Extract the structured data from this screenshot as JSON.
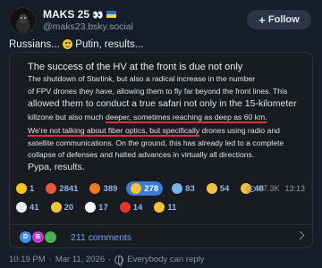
{
  "author": {
    "name": "MAKS 25",
    "emoji": "👀",
    "handle": "@maks23.bsky.social"
  },
  "follow_button": {
    "label": "Follow"
  },
  "post": {
    "text": "Russians... ",
    "text_tail": " Putin, results..."
  },
  "card": {
    "title": "The success of the HV at the front is due not only",
    "lines": [
      "The shutdown of Starlink, but also a radical increase in the number",
      "of FPV drones they have, allowing them to fly far beyond the front lines. This",
      "allowed them to conduct a true safari not only in the 15-kilometer",
      "killzone but also much deeper, sometimes reaching as deep as 60 km.",
      "We're not talking about fiber optics, but specifically drones using radio and",
      "satellite communications. On the ground, this has already led to a complete",
      "collapse of defenses and halted advances in virtually all directions.",
      "Pypa, results."
    ],
    "line4_pre": "killzone but also much ",
    "line4_underlined": "deeper, sometimes reaching as deep as 60 km.",
    "line5_underlined": "We're not talking about fiber optics, but specifically",
    "line5_post": " drones using radio and"
  },
  "reactions": {
    "row1": [
      {
        "icon": "star-icon",
        "count": "1",
        "color": "#f5c518"
      },
      {
        "icon": "angry-face-icon",
        "count": "2841",
        "color": "#e25b3c"
      },
      {
        "icon": "fire-icon",
        "count": "389",
        "color": "#f07a1a"
      },
      {
        "icon": "laughing-face-icon",
        "count": "278",
        "color": "#f6c23e",
        "active": true
      },
      {
        "icon": "shocked-face-icon",
        "count": "83",
        "color": "#7ab3e8"
      },
      {
        "icon": "thumbs-up-icon",
        "count": "54",
        "color": "#f6c23e"
      },
      {
        "icon": "thinking-face-icon",
        "count": "48",
        "color": "#f6c23e"
      }
    ],
    "row2": [
      {
        "icon": "clown-icon",
        "count": "41",
        "color": "#e9eef3"
      },
      {
        "icon": "party-face-icon",
        "count": "20",
        "color": "#f6c23e"
      },
      {
        "icon": "eyes-icon",
        "count": "17",
        "color": "#ffffff"
      },
      {
        "icon": "hundred-icon",
        "count": "14",
        "color": "#e3342f"
      },
      {
        "icon": "tears-face-icon",
        "count": "11",
        "color": "#f6c23e"
      }
    ],
    "views": "87.3K",
    "time": "13:13"
  },
  "comments": {
    "label": "211 comments",
    "avatars": [
      {
        "letter": "D",
        "color": "#3f8ee8"
      },
      {
        "letter": "B",
        "color": "#c13cc8"
      },
      {
        "letter": "",
        "color": "#4cae4f"
      }
    ]
  },
  "footer": {
    "time": "10:19 PM",
    "date": "Mar 11, 2026",
    "reply_setting": "Everybody can reply"
  }
}
